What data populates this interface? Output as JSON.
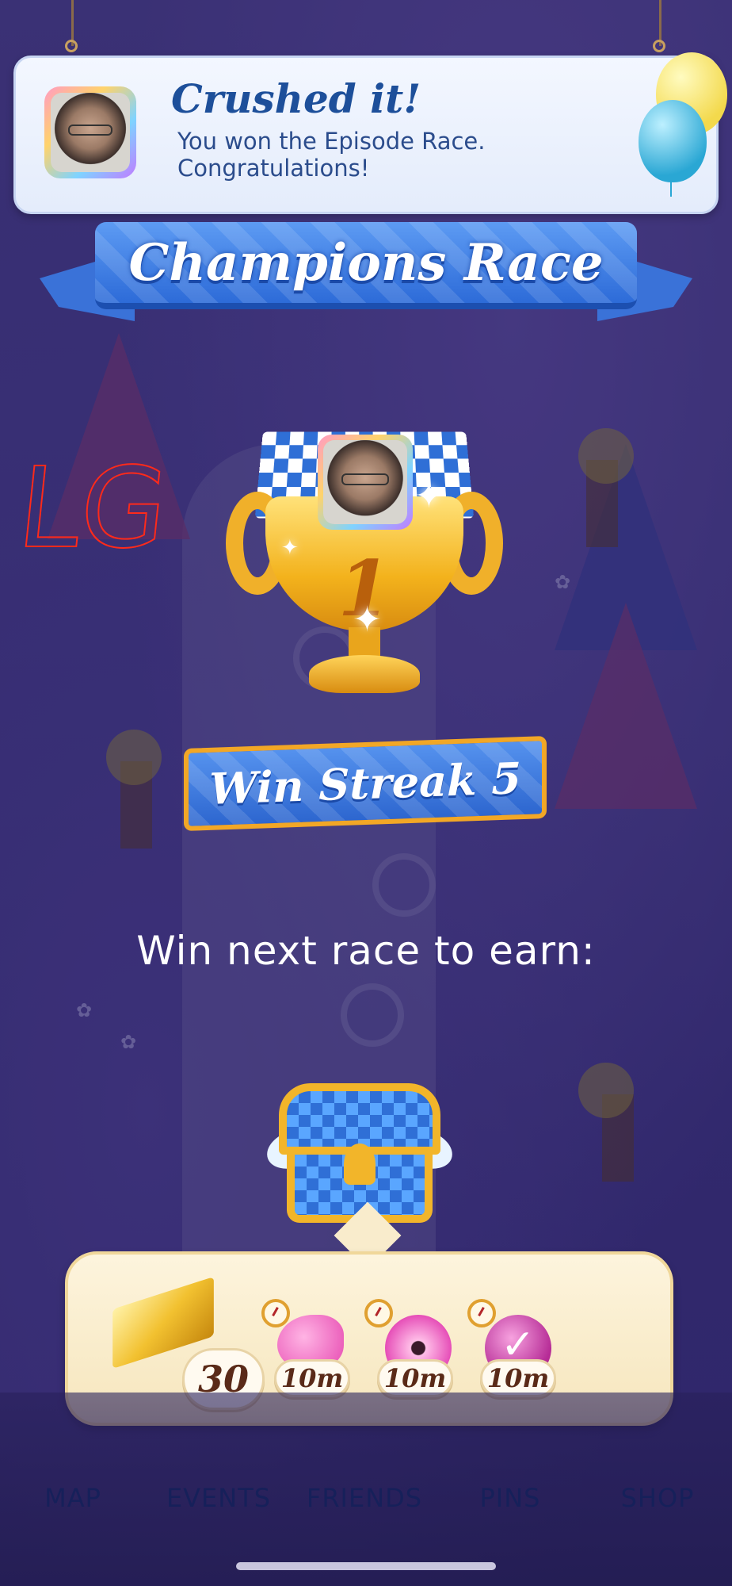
{
  "notification": {
    "title": "Crushed it!",
    "message": "You won the Episode Race. Congratulations!"
  },
  "race": {
    "title": "Champions Race",
    "place": "1",
    "streak_label": "Win Streak 5",
    "next_prompt": "Win next race to earn:"
  },
  "rewards": {
    "gold_amount": "30",
    "boosters": [
      {
        "icon": "fish-booster-icon",
        "duration": "10m"
      },
      {
        "icon": "donut-booster-icon",
        "duration": "10m"
      },
      {
        "icon": "wrapped-candy-booster-icon",
        "duration": "10m"
      }
    ]
  },
  "nav": {
    "items": [
      {
        "label": "MAP"
      },
      {
        "label": "EVENTS"
      },
      {
        "label": "FRIENDS"
      },
      {
        "label": "PINS"
      },
      {
        "label": "SHOP"
      }
    ]
  },
  "handwriting": "LG",
  "colors": {
    "accent_blue": "#2d6bd8",
    "gold": "#f2b52a",
    "panel_cream": "#fdf4dd"
  }
}
